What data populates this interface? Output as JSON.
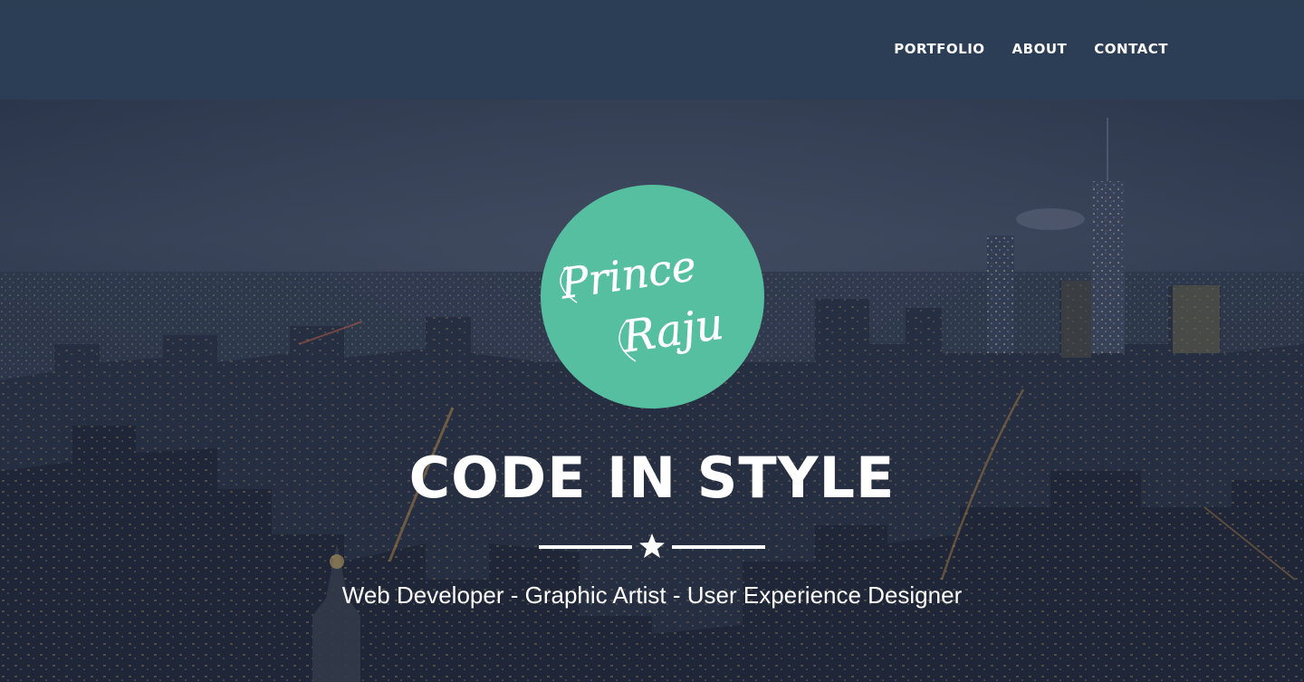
{
  "nav": {
    "items": [
      {
        "label": "PORTFOLIO"
      },
      {
        "label": "ABOUT"
      },
      {
        "label": "CONTACT"
      }
    ]
  },
  "logo": {
    "line1": "Prince",
    "line2": "Raju",
    "color": "#55bf9f"
  },
  "hero": {
    "headline": "CODE IN STYLE",
    "divider_icon": "star-icon",
    "tagline": "Web Developer - Graphic Artist - User Experience Designer"
  },
  "colors": {
    "navbar": "#2c3e55",
    "accent": "#55bf9f",
    "text": "#ffffff"
  }
}
